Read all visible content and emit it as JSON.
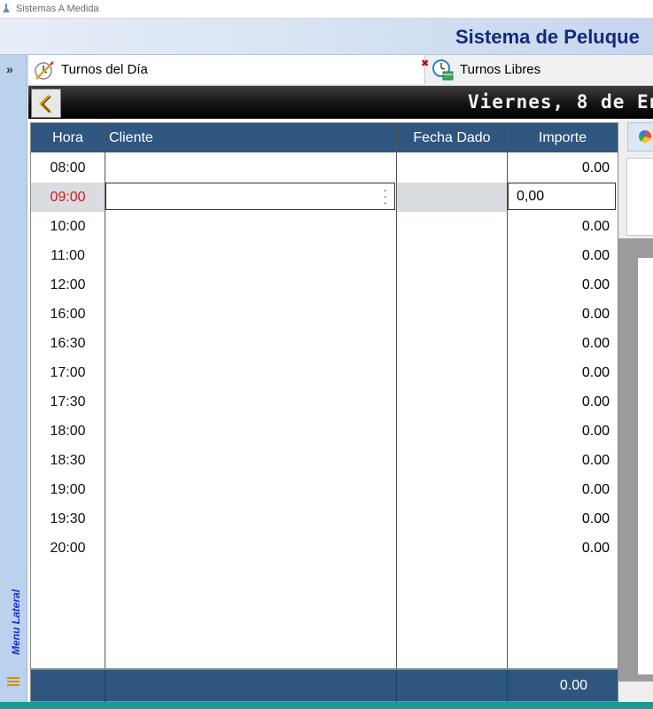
{
  "window": {
    "title": "Sistemas A Medida"
  },
  "header": {
    "system_title": "Sistema de Peluque"
  },
  "side_menu": {
    "label": "Menu Lateral"
  },
  "tabs": [
    {
      "label": "Turnos del Día",
      "icon": "clock-edit-icon",
      "active": true
    },
    {
      "label": "Turnos Libres",
      "icon": "clock-calendar-icon",
      "active": false
    }
  ],
  "date_bar": {
    "text": "Viernes, 8 de En"
  },
  "grid": {
    "columns": [
      "Hora",
      "Cliente",
      "Fecha Dado",
      "Importe"
    ],
    "rows": [
      {
        "hora": "08:00",
        "cliente": "",
        "fecha": "",
        "importe": "0.00"
      },
      {
        "hora": "09:00",
        "cliente": "",
        "fecha": "",
        "importe": "0,00",
        "selected": true
      },
      {
        "hora": "10:00",
        "cliente": "",
        "fecha": "",
        "importe": "0.00"
      },
      {
        "hora": "11:00",
        "cliente": "",
        "fecha": "",
        "importe": "0.00"
      },
      {
        "hora": "12:00",
        "cliente": "",
        "fecha": "",
        "importe": "0.00"
      },
      {
        "hora": "16:00",
        "cliente": "",
        "fecha": "",
        "importe": "0.00"
      },
      {
        "hora": "16:30",
        "cliente": "",
        "fecha": "",
        "importe": "0.00"
      },
      {
        "hora": "17:00",
        "cliente": "",
        "fecha": "",
        "importe": "0.00"
      },
      {
        "hora": "17:30",
        "cliente": "",
        "fecha": "",
        "importe": "0.00"
      },
      {
        "hora": "18:00",
        "cliente": "",
        "fecha": "",
        "importe": "0.00"
      },
      {
        "hora": "18:30",
        "cliente": "",
        "fecha": "",
        "importe": "0.00"
      },
      {
        "hora": "19:00",
        "cliente": "",
        "fecha": "",
        "importe": "0.00"
      },
      {
        "hora": "19:30",
        "cliente": "",
        "fecha": "",
        "importe": "0.00"
      },
      {
        "hora": "20:00",
        "cliente": "",
        "fecha": "",
        "importe": "0.00"
      }
    ],
    "total": "0.00"
  },
  "colors": {
    "header_blue": "#2e567e",
    "selected_hour": "#d11c1c",
    "title_blue": "#142a7a",
    "accent_teal": "#1a9a95"
  }
}
